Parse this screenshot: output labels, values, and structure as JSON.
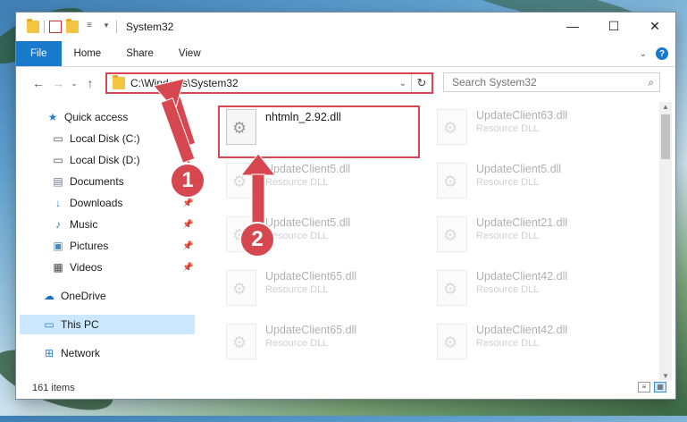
{
  "window": {
    "title": "System32"
  },
  "window_controls": {
    "minimize": "—",
    "maximize": "☐",
    "close": "✕"
  },
  "ribbon": {
    "tabs": [
      "File",
      "Home",
      "Share",
      "View"
    ],
    "help": "?"
  },
  "address_bar": {
    "path": "C:\\Windows\\System32"
  },
  "search": {
    "placeholder": "Search System32"
  },
  "sidebar": {
    "items": [
      {
        "label": "Quick access",
        "icon": "star-icon"
      },
      {
        "label": "Local Disk (C:)",
        "icon": "drive-icon",
        "pinned": true
      },
      {
        "label": "Local Disk (D:)",
        "icon": "drive-icon",
        "pinned": true
      },
      {
        "label": "Documents",
        "icon": "documents-icon",
        "pinned": true
      },
      {
        "label": "Downloads",
        "icon": "download-icon",
        "pinned": true
      },
      {
        "label": "Music",
        "icon": "music-icon",
        "pinned": true
      },
      {
        "label": "Pictures",
        "icon": "pictures-icon",
        "pinned": true
      },
      {
        "label": "Videos",
        "icon": "videos-icon",
        "pinned": true
      },
      {
        "label": "OneDrive",
        "icon": "cloud-icon"
      },
      {
        "label": "This PC",
        "icon": "computer-icon",
        "selected": true
      },
      {
        "label": "Network",
        "icon": "network-icon"
      }
    ]
  },
  "files": {
    "highlighted": {
      "name": "nhtmln_2.92.dll"
    },
    "left_column": [
      {
        "name": "UpdateClient5.dll",
        "type": "Resource DLL"
      },
      {
        "name": "UpdateClient5.dll",
        "type": "Resource DLL"
      },
      {
        "name": "UpdateClient65.dll",
        "type": "Resource DLL"
      },
      {
        "name": "UpdateClient65.dll",
        "type": "Resource DLL"
      }
    ],
    "right_column": [
      {
        "name": "UpdateClient63.dll",
        "type": "Resource DLL"
      },
      {
        "name": "UpdateClient5.dll",
        "type": "Resource DLL"
      },
      {
        "name": "UpdateClient21.dll",
        "type": "Resource DLL"
      },
      {
        "name": "UpdateClient42.dll",
        "type": "Resource DLL"
      },
      {
        "name": "UpdateClient42.dll",
        "type": "Resource DLL"
      }
    ]
  },
  "status_bar": {
    "item_count": "161 items"
  },
  "annotations": {
    "step1": "1",
    "step2": "2",
    "color": "#d6474f"
  }
}
